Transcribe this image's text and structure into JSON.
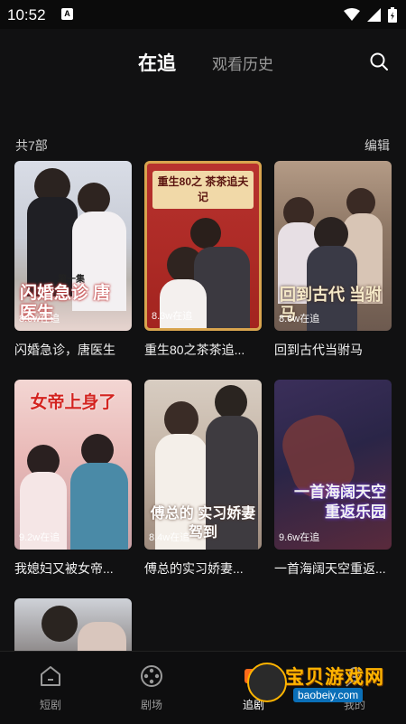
{
  "status_bar": {
    "time": "10:52",
    "notif_label": "A"
  },
  "header": {
    "tabs": [
      {
        "label": "在追",
        "active": true
      },
      {
        "label": "观看历史",
        "active": false
      }
    ],
    "search_icon": "search-icon"
  },
  "list": {
    "count_label": "共7部",
    "edit_label": "编辑"
  },
  "cards": [
    {
      "title": "闪婚急诊，唐医生",
      "badge": "8.6w在追",
      "overlay": "闪婚急诊 唐医生",
      "top": "第一集"
    },
    {
      "title": "重生80之茶茶追...",
      "badge": "8.3w在追",
      "overlay": "",
      "top": "重生80之 茶茶追夫记"
    },
    {
      "title": "回到古代当驸马",
      "badge": "8.6w在追",
      "overlay": "回到古代 当驸马",
      "top": ""
    },
    {
      "title": "我媳妇又被女帝...",
      "badge": "9.2w在追",
      "overlay": "",
      "top": "女帝上身了"
    },
    {
      "title": "傅总的实习娇妻...",
      "badge": "8.4w在追",
      "overlay": "傅总的 实习娇妻驾到",
      "top": ""
    },
    {
      "title": "一首海阔天空重返...",
      "badge": "9.6w在追",
      "overlay": "一首海阔天空 重返乐园",
      "top": ""
    },
    {
      "title": "",
      "badge": "",
      "overlay": "",
      "top": ""
    }
  ],
  "bottom_nav": [
    {
      "label": "短剧",
      "icon": "home-icon",
      "active": false
    },
    {
      "label": "剧场",
      "icon": "film-reel-icon",
      "active": false
    },
    {
      "label": "追剧",
      "icon": "bookmark-icon",
      "active": true
    },
    {
      "label": "我的",
      "icon": "profile-icon",
      "active": false
    }
  ],
  "watermark": {
    "text": "宝贝游戏网",
    "url": "baobeiy.com"
  },
  "colors": {
    "background": "#111112",
    "accent": "#ffb400",
    "text_secondary": "#9a9a9a"
  }
}
